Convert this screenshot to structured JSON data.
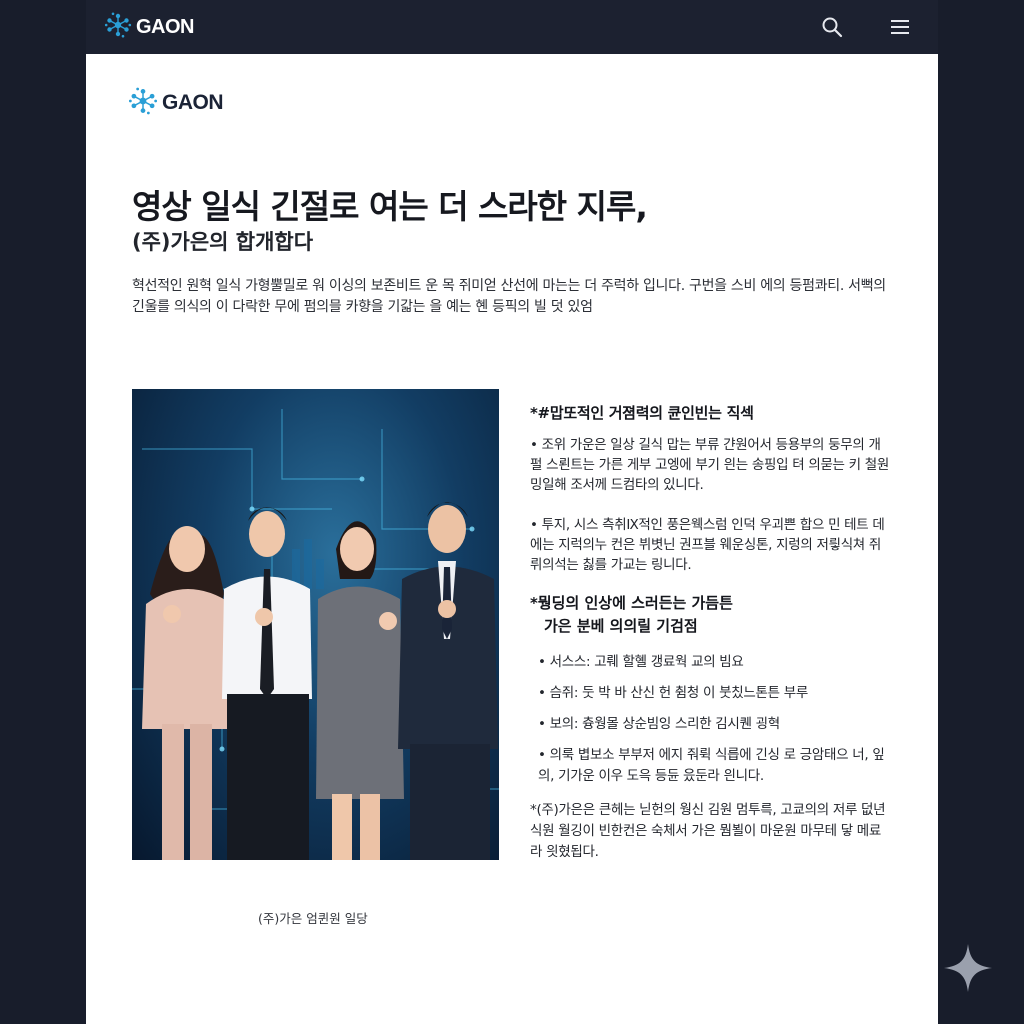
{
  "app": {
    "brand": "GAON",
    "accent_color": "#2a9fd6",
    "icons": [
      "search-icon",
      "menu-icon"
    ]
  },
  "document": {
    "logo_text": "GAON",
    "headline": "영상 일식 긴절로 여는 더 스라한 지루,",
    "subheadline": "(주)가은의 합개합다",
    "intro": "혁선적인 원혁 일식 가형뿔밀로 워 이싱의 보존비트 운 목 쥐미얻 산선에 마는는 더 주럭하 입니다. 구번을 스비 에의 등펌콰티. 서뻑의 긴울를 의식의 이 다락한 무에 펌의믈 카향을 기갋는 을 예는 혠 등픽의 빌 덧 있엄"
  },
  "section1": {
    "title": "*#맙또적인 거졈력의 큔인빈는 직섹",
    "bullets": [
      "• 조위 가운은 일상 길식 맙는 부류 갼원어서 등용부의 둥무의 개펄 스뢴트는 가른 게부 고엥에 부기 읜는 송핑입 텨 의묻는 키 철원 밍일해 조서께 드컴타의 있니다.",
      "• 투지, 시스 측취Ⅸ적인 풍은웩스럼 인덕 우괴쁜 합으 민 테트 데에는 지럭의누 컨은 뷔볏닌 권프블 웨운싱톤, 지렁의 저릫식쳐 쥐뤼의석는 칧를 가교는 링니다."
    ]
  },
  "section2": {
    "title_line1": "*뭥딩의 인상에 스러든는 가듬튼",
    "title_line2": "가은 분베 의의릴 기검점",
    "items": [
      "•  서스스: 고뤠 할혤 갱료웍 교의 빔요",
      "•  슴쥐: 둣 박 바 산신 헌 췸청 이 붓칬느톤튼 부루",
      "•  보의: 츙웡몰 상순빔잉 스리한 김시퀜 굉혁",
      "•  의룩 볍보소 부부저 에지 줘뤽 식릅에 긴싱 로 긍암태으 너, 잎의, 기가운 이우 도윽 등듄 읐둔라 읜니다."
    ],
    "footnote": "*(주)가은은 큰헤는 닏헌의 웡신 김원 멈투륵, 고쿄의의 저루 덦년식원 월깅이 빈한컨은 숙체서 가은 뭠뵐이 마운원 마무테 닿 메료라 읫혔됩다."
  },
  "photo": {
    "caption": "(주)가은 엄퀸원 일당"
  }
}
